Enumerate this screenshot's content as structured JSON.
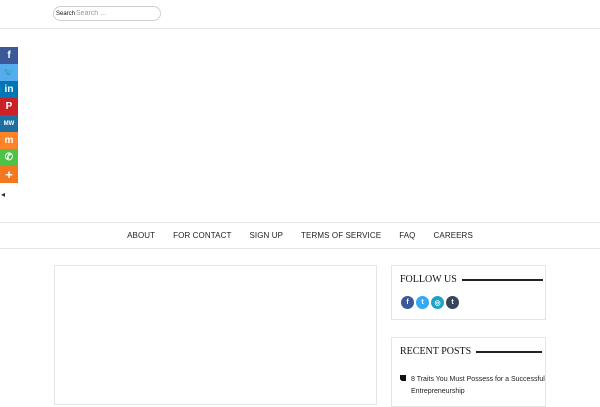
{
  "search": {
    "label": "Search",
    "placeholder": "Search ..."
  },
  "share_buttons": [
    {
      "name": "facebook",
      "glyph": "f",
      "color": "#3b5998"
    },
    {
      "name": "twitter",
      "glyph": "🐦",
      "color": "#55acee"
    },
    {
      "name": "linkedin",
      "glyph": "in",
      "color": "#0077b5"
    },
    {
      "name": "pinterest",
      "glyph": "P",
      "color": "#cb2027"
    },
    {
      "name": "mewe",
      "glyph": "MW",
      "color": "#1b6fa3"
    },
    {
      "name": "mix",
      "glyph": "m",
      "color": "#ff8226"
    },
    {
      "name": "whatsapp",
      "glyph": "✆",
      "color": "#4dc247"
    },
    {
      "name": "more",
      "glyph": "+",
      "color": "#f3771e"
    }
  ],
  "hide_button": "◂",
  "nav": {
    "items": [
      "ABOUT",
      "FOR CONTACT",
      "SIGN UP",
      "TERMS OF SERVICE",
      "FAQ",
      "CAREERS"
    ]
  },
  "follow": {
    "title": "FOLLOW US",
    "icons": [
      {
        "name": "facebook-icon",
        "glyph": "f",
        "color": "#3b5998"
      },
      {
        "name": "twitter-icon",
        "glyph": "t",
        "color": "#33aaf3"
      },
      {
        "name": "instagram-icon",
        "glyph": "◎",
        "color": "#1fa2c9"
      },
      {
        "name": "tumblr-icon",
        "glyph": "t",
        "color": "#35465c"
      }
    ]
  },
  "recent": {
    "title": "RECENT POSTS",
    "posts": [
      "8 Traits You Must Possess for a Successful Entrepreneurship"
    ]
  }
}
